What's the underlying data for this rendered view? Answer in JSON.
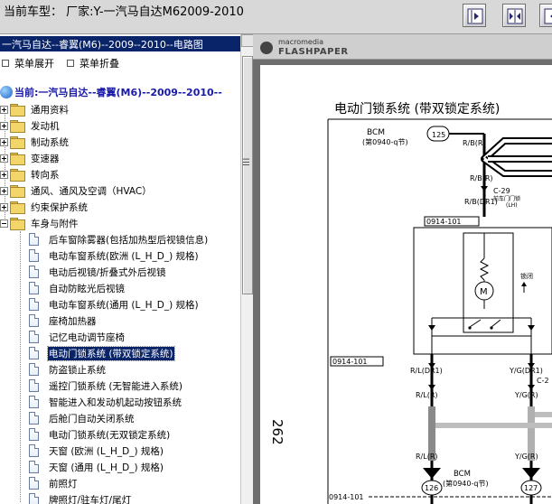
{
  "window": {
    "title": "当前车型：  厂家:Y-一汽马自达M62009-2010"
  },
  "toolbar": {
    "buttons": [
      "expand-right-icon",
      "fit-width-icon",
      "collapse-left-icon"
    ]
  },
  "tree": {
    "header": "一汽马自达--睿翼(M6)--2009--2010--电路图",
    "menu_expand": "菜单展开",
    "menu_collapse": "菜单折叠",
    "root": "当前:一汽马自达--睿翼(M6)--2009--2010--",
    "folders": [
      {
        "label": "通用资料",
        "expanded": false
      },
      {
        "label": "发动机",
        "expanded": false
      },
      {
        "label": "制动系统",
        "expanded": false
      },
      {
        "label": "变速器",
        "expanded": false
      },
      {
        "label": "转向系",
        "expanded": false
      },
      {
        "label": "通风、通风及空调（HVAC）",
        "expanded": false
      },
      {
        "label": "约束保护系统",
        "expanded": false
      },
      {
        "label": "车身与附件",
        "expanded": true
      }
    ],
    "items": [
      {
        "label": "后车窗除雾器(包括加热型后视镜信息)",
        "selected": false
      },
      {
        "label": "电动车窗系统(欧洲 (L_H_D_) 规格)",
        "selected": false
      },
      {
        "label": "电动后视镜/折叠式外后视镜",
        "selected": false
      },
      {
        "label": "自动防眩光后视镜",
        "selected": false
      },
      {
        "label": "电动车窗系统(通用 (L_H_D_) 规格)",
        "selected": false
      },
      {
        "label": "座椅加热器",
        "selected": false
      },
      {
        "label": "记忆电动调节座椅",
        "selected": false
      },
      {
        "label": "电动门锁系统 (带双锁定系统)",
        "selected": true
      },
      {
        "label": "防盗锁止系统",
        "selected": false
      },
      {
        "label": "遥控门锁系统 (无智能进入系统)",
        "selected": false
      },
      {
        "label": "智能进入和发动机起动按钮系统",
        "selected": false
      },
      {
        "label": "后舱门自动关闭系统",
        "selected": false
      },
      {
        "label": "电动门锁系统(无双锁定系统)",
        "selected": false
      },
      {
        "label": "天窗  (欧洲 (L_H_D_) 规格)",
        "selected": false
      },
      {
        "label": "天窗  (通用 (L_H_D_) 规格)",
        "selected": false
      },
      {
        "label": "前照灯",
        "selected": false
      },
      {
        "label": "牌照灯/驻车灯/尾灯",
        "selected": false
      }
    ]
  },
  "viewer": {
    "brand_top": "macromedia",
    "brand_bottom": "FLASHPAPER",
    "page_number": "262",
    "diagram_title": "电动门锁系统 (带双锁定系统)",
    "labels": {
      "bcm_top": "BCM",
      "bcm_top_ref": "(第0940-q节)",
      "bcm_bottom": "BCM",
      "bcm_bottom_ref": "(第0940-q节)",
      "pin_125": "125",
      "pin_126": "126",
      "pin_127": "127",
      "wire_rb_r_1": "R/B(R)",
      "wire_rb_r_2": "R/B(R)",
      "wire_rb_dr1": "R/B(DR1)",
      "connector_c29": "C-29",
      "connector_c29_desc": "前车门门锁",
      "connector_c29_side": "(LH)",
      "connector_c2": "C-2",
      "conn_0914_101_a": "0914-101",
      "conn_0914_101_b": "0914-101",
      "conn_0914_101_c": "0914-101",
      "lock_label": "锁闭",
      "motor": "M",
      "wire_rl_dr1": "R/L(DR1)",
      "wire_yg_dr1": "Y/G(DR1)",
      "wire_rl_r_1": "R/L(R)",
      "wire_yg_r_1": "Y/G(R)",
      "wire_rl_r_2": "R/L(R)",
      "wire_yg_r_2": "Y/G(R)"
    }
  }
}
